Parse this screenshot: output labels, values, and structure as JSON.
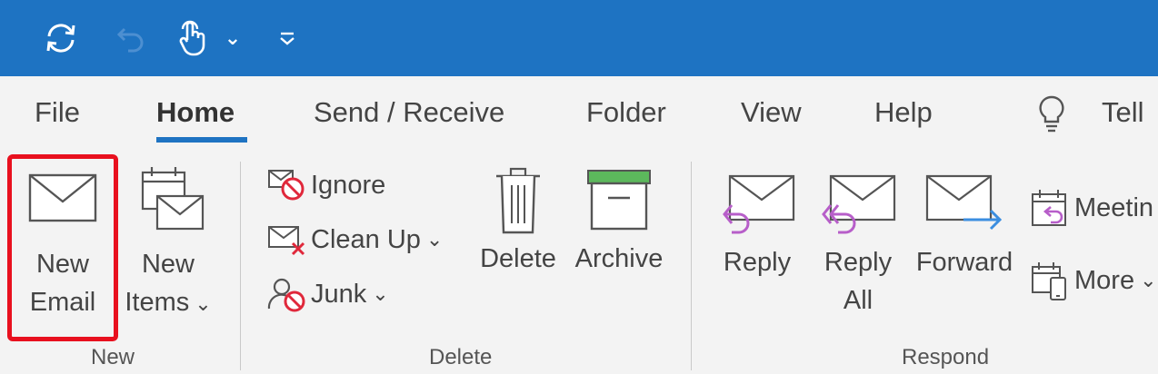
{
  "quick_access": {
    "sync_icon": "sync-icon",
    "undo_icon": "undo-icon",
    "touch_icon": "touch-mode-icon",
    "touch_dropdown": "⌄",
    "customize_icon": "customize-qat-icon"
  },
  "tabs": [
    {
      "label": "File"
    },
    {
      "label": "Home",
      "active": true
    },
    {
      "label": "Send / Receive"
    },
    {
      "label": "Folder"
    },
    {
      "label": "View"
    },
    {
      "label": "Help"
    },
    {
      "label": "Tell"
    }
  ],
  "ribbon": {
    "new_group": {
      "label": "New",
      "new_email": {
        "line1": "New",
        "line2": "Email"
      },
      "new_items": {
        "line1": "New",
        "line2": "Items",
        "caret": "⌄"
      }
    },
    "delete_group": {
      "label": "Delete",
      "ignore": "Ignore",
      "clean_up": "Clean Up",
      "clean_up_caret": "⌄",
      "junk": "Junk",
      "junk_caret": "⌄",
      "delete": "Delete",
      "archive": "Archive"
    },
    "respond_group": {
      "label": "Respond",
      "reply": "Reply",
      "reply_all": {
        "line1": "Reply",
        "line2": "All"
      },
      "forward": "Forward",
      "meeting": "Meetin",
      "more": "More",
      "more_caret": "⌄"
    }
  },
  "colors": {
    "titlebar": "#1e73c2",
    "accent": "#1e73c2",
    "highlight": "#e8101e",
    "ribbon_bg": "#f3f3f3",
    "reply_purple": "#b75ec9",
    "forward_blue": "#3b8ee0",
    "archive_green": "#5cb85c",
    "ignore_red": "#e0283b"
  }
}
